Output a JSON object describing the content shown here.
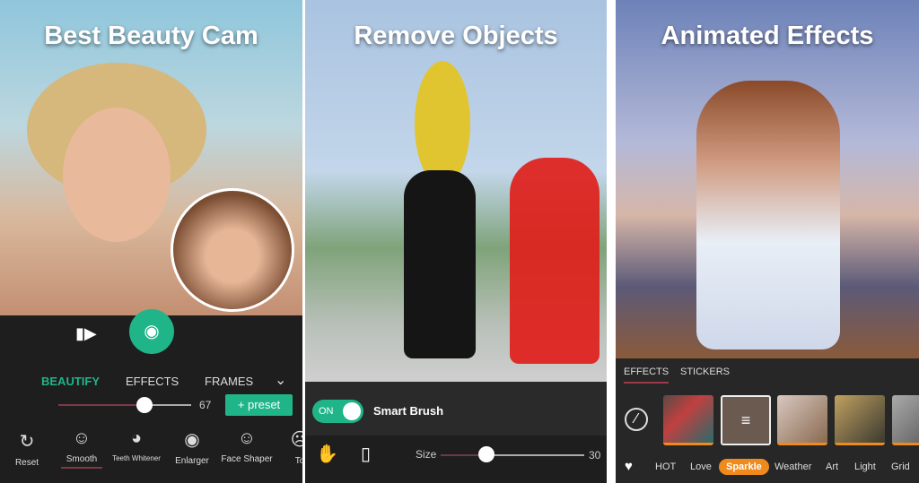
{
  "panel1": {
    "headline": "Best Beauty Cam",
    "icons": {
      "video": "video-camera-icon",
      "camera": "camera-icon"
    },
    "accent": "#1fb589",
    "tabs": [
      {
        "label": "BEAUTIFY",
        "active": true
      },
      {
        "label": "EFFECTS"
      },
      {
        "label": "FRAMES"
      }
    ],
    "slider_value": "67",
    "slider_fraction": 0.67,
    "preset_label": "+ preset",
    "tools": [
      {
        "label": "Reset",
        "icon": "reset-icon"
      },
      {
        "label": "Smooth",
        "icon": "face-icon",
        "active": true
      },
      {
        "label": "Teeth Whitener",
        "icon": "lips-icon"
      },
      {
        "label": "Enlarger",
        "icon": "eye-icon"
      },
      {
        "label": "Face Shaper",
        "icon": "face-shaper-icon"
      },
      {
        "label": "To",
        "icon": "face-icon"
      }
    ]
  },
  "panel2": {
    "headline": "Remove Objects",
    "toggle_label": "ON",
    "toggle_on": true,
    "smart_brush_label": "Smart Brush",
    "size_label": "Size",
    "size_value": "30",
    "size_fraction": 0.3,
    "icons": {
      "brush": "brush-hand-icon",
      "eraser": "eraser-icon"
    }
  },
  "panel3": {
    "headline": "Animated Effects",
    "tabs": [
      {
        "label": "EFFECTS",
        "active": true
      },
      {
        "label": "STICKERS"
      }
    ],
    "categories": [
      "HOT",
      "Love",
      "Sparkle",
      "Weather",
      "Art",
      "Light",
      "Grid"
    ],
    "active_category": "Sparkle",
    "accent": "#f08a1c"
  }
}
